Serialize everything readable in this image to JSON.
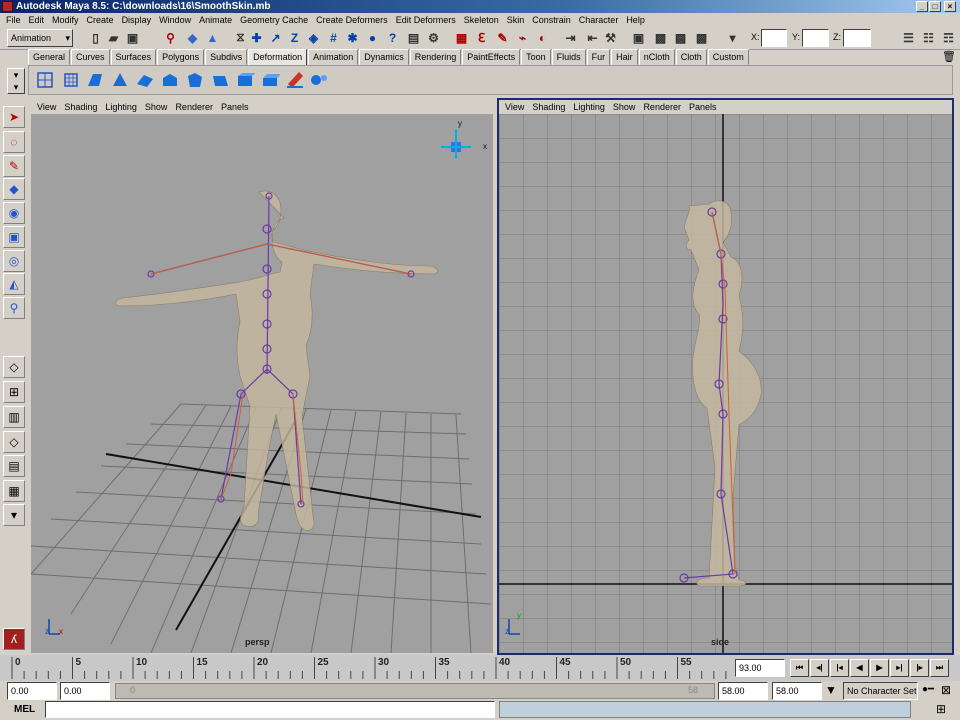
{
  "window": {
    "title": "Autodesk Maya 8.5: C:\\downloads\\16\\SmoothSkin.mb"
  },
  "menu": [
    "File",
    "Edit",
    "Modify",
    "Create",
    "Display",
    "Window",
    "Animate",
    "Geometry Cache",
    "Create Deformers",
    "Edit Deformers",
    "Skeleton",
    "Skin",
    "Constrain",
    "Character",
    "Help"
  ],
  "status": {
    "menuset": "Animation",
    "x_label": "X:",
    "y_label": "Y:",
    "z_label": "Z:"
  },
  "shelf_tabs": [
    "General",
    "Curves",
    "Surfaces",
    "Polygons",
    "Subdivs",
    "Deformation",
    "Animation",
    "Dynamics",
    "Rendering",
    "PaintEffects",
    "Toon",
    "Fluids",
    "Fur",
    "Hair",
    "nCloth",
    "Cloth",
    "Custom"
  ],
  "active_shelf": "Deformation",
  "viewport_menu": [
    "View",
    "Shading",
    "Lighting",
    "Show",
    "Renderer",
    "Panels"
  ],
  "persp": {
    "label": "persp",
    "axis_y": "y",
    "axis_z": "z",
    "axis_x": "x"
  },
  "side": {
    "label": "side",
    "axis_y": "y",
    "axis_z": "z"
  },
  "timeline": {
    "ticks": [
      "0",
      "5",
      "10",
      "15",
      "20",
      "25",
      "30",
      "35",
      "40",
      "45",
      "50",
      "55"
    ],
    "current_frame": "93.00"
  },
  "range": {
    "start": "0.00",
    "playback_start": "0.00",
    "range_start_label": "0",
    "range_end_label": "58",
    "playback_end": "58.00",
    "end": "58.00",
    "character_set": "No Character Set"
  },
  "cmd": {
    "label": "MEL"
  }
}
